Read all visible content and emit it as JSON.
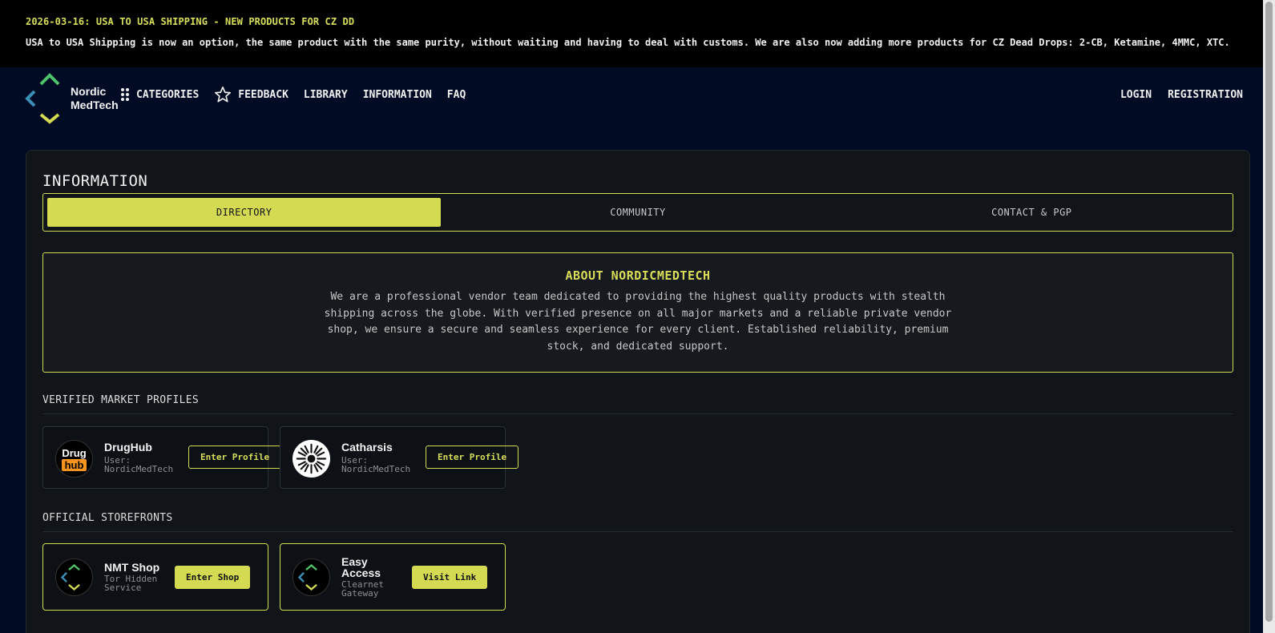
{
  "announcement": {
    "title": "2026-03-16: USA TO USA SHIPPING - NEW PRODUCTS FOR CZ DD",
    "text": "USA to USA Shipping is now an option, the same product with the same purity, without waiting and having to deal with customs. We are also now adding more products for CZ Dead Drops: 2-CB, Ketamine, 4MMC, XTC."
  },
  "brand": {
    "line1": "Nordic",
    "line2": "MedTech"
  },
  "nav": {
    "categories": "CATEGORIES",
    "feedback": "FEEDBACK",
    "library": "LIBRARY",
    "information": "INFORMATION",
    "faq": "FAQ",
    "login": "LOGIN",
    "registration": "REGISTRATION"
  },
  "page": {
    "title": "INFORMATION"
  },
  "tabs": [
    {
      "label": "DIRECTORY",
      "active": true
    },
    {
      "label": "COMMUNITY",
      "active": false
    },
    {
      "label": "CONTACT & PGP",
      "active": false
    }
  ],
  "about": {
    "title": "ABOUT NORDICMEDTECH",
    "text": "We are a professional vendor team dedicated to providing the highest quality products with stealth shipping across the globe. With verified presence on all major markets and a reliable private vendor shop, we ensure a secure and seamless experience for every client. Established reliability, premium stock, and dedicated support."
  },
  "sections": {
    "markets_title": "VERIFIED MARKET PROFILES",
    "storefronts_title": "OFFICIAL STOREFRONTS"
  },
  "markets": [
    {
      "name": "DrugHub",
      "sub1": "User:",
      "sub2": "NordicMedTech",
      "button": "Enter Profile",
      "logo_top": "Drug",
      "logo_bottom": "hub"
    },
    {
      "name": "Catharsis",
      "sub1": "User:",
      "sub2": "NordicMedTech",
      "button": "Enter Profile"
    }
  ],
  "storefronts": [
    {
      "name": "NMT Shop",
      "sub1": "Tor Hidden",
      "sub2": "Service",
      "button": "Enter Shop"
    },
    {
      "name1": "Easy",
      "name2": "Access",
      "sub1": "Clearnet",
      "sub2": "Gateway",
      "button": "Visit Link"
    }
  ],
  "colors": {
    "accent": "#d4da52",
    "background": "#020b24",
    "panel": "#111419",
    "logo_green": "#4cc36a",
    "logo_blue": "#3a8fb7",
    "logo_yellow": "#d4da52",
    "hub_orange": "#f7941d"
  },
  "icons": {
    "categories": "grid-dots-icon",
    "feedback": "star-outline-icon"
  }
}
